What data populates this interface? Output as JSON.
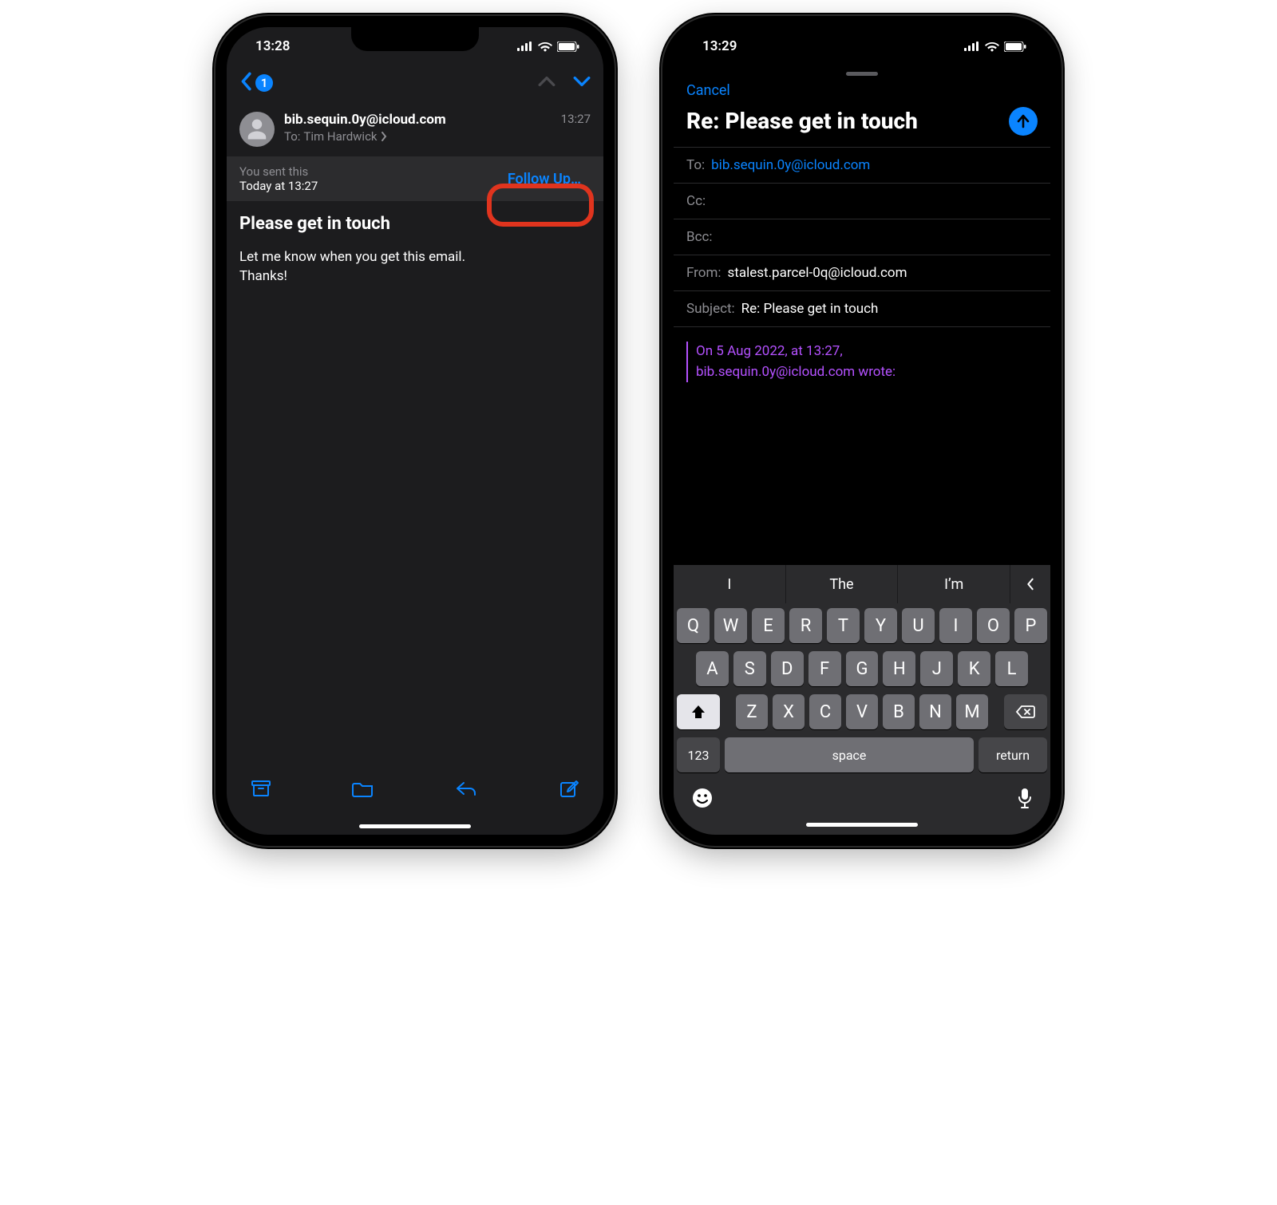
{
  "left": {
    "status_time": "13:28",
    "back_badge": "1",
    "from": "bib.sequin.0y@icloud.com",
    "to_label": "To:",
    "to_name": "Tim Hardwick",
    "sent_time": "13:27",
    "followup_line1": "You sent this",
    "followup_line2": "Today at 13:27",
    "followup_btn": "Follow Up…",
    "subject": "Please get in touch",
    "body_l1": "Let me know when you get this email.",
    "body_l2": "Thanks!"
  },
  "right": {
    "status_time": "13:29",
    "cancel": "Cancel",
    "title": "Re: Please get in touch",
    "to_label": "To:",
    "to_value": "bib.sequin.0y@icloud.com",
    "cc_label": "Cc:",
    "bcc_label": "Bcc:",
    "from_label": "From:",
    "from_value": "stalest.parcel-0q@icloud.com",
    "subject_label": "Subject:",
    "subject_value": "Re: Please get in touch",
    "quote_l1": "On 5 Aug 2022, at 13:27,",
    "quote_l2": "bib.sequin.0y@icloud.com wrote:",
    "pred1": "I",
    "pred2": "The",
    "pred3": "I’m",
    "row1": [
      "Q",
      "W",
      "E",
      "R",
      "T",
      "Y",
      "U",
      "I",
      "O",
      "P"
    ],
    "row2": [
      "A",
      "S",
      "D",
      "F",
      "G",
      "H",
      "J",
      "K",
      "L"
    ],
    "row3": [
      "Z",
      "X",
      "C",
      "V",
      "B",
      "N",
      "M"
    ],
    "num_key": "123",
    "space_key": "space",
    "return_key": "return"
  }
}
